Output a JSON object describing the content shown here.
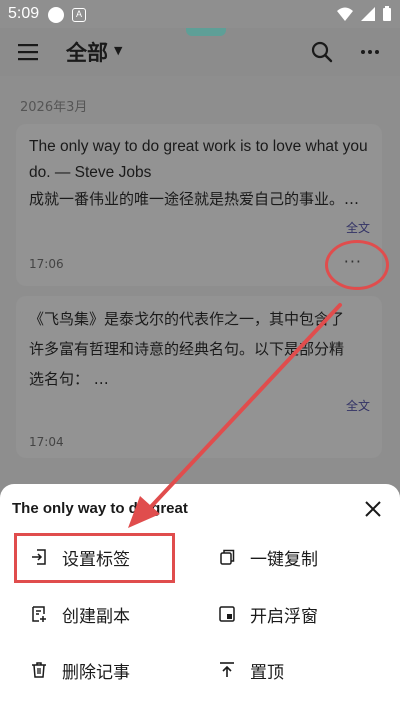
{
  "status_bar": {
    "time": "5:09",
    "badge": "A"
  },
  "app_bar": {
    "title": "全部"
  },
  "section": {
    "date": "2026年3月"
  },
  "cards": [
    {
      "lines": [
        "The only way to do great work is to love what you",
        "do. — Steve Jobs",
        "成就一番伟业的唯一途径就是热爱自己的事业。…"
      ],
      "more": "全文",
      "time": "17:06",
      "dots": "···"
    },
    {
      "lines": [
        "《飞鸟集》是泰戈尔的代表作之一，其中包含了",
        "许多富有哲理和诗意的经典名句。以下是部分精",
        "选名句：  …"
      ],
      "more": "全文",
      "time": "17:04"
    }
  ],
  "sheet": {
    "title": "The only way to do great",
    "actions": [
      {
        "label": "设置标签",
        "icon": "tag-in-icon"
      },
      {
        "label": "一键复制",
        "icon": "copy-icon"
      },
      {
        "label": "创建副本",
        "icon": "duplicate-icon"
      },
      {
        "label": "开启浮窗",
        "icon": "float-window-icon"
      },
      {
        "label": "删除记事",
        "icon": "trash-icon"
      },
      {
        "label": "置顶",
        "icon": "pin-top-icon"
      }
    ]
  },
  "colors": {
    "annotation": "#e04d4d",
    "accent": "#5e9f97"
  }
}
